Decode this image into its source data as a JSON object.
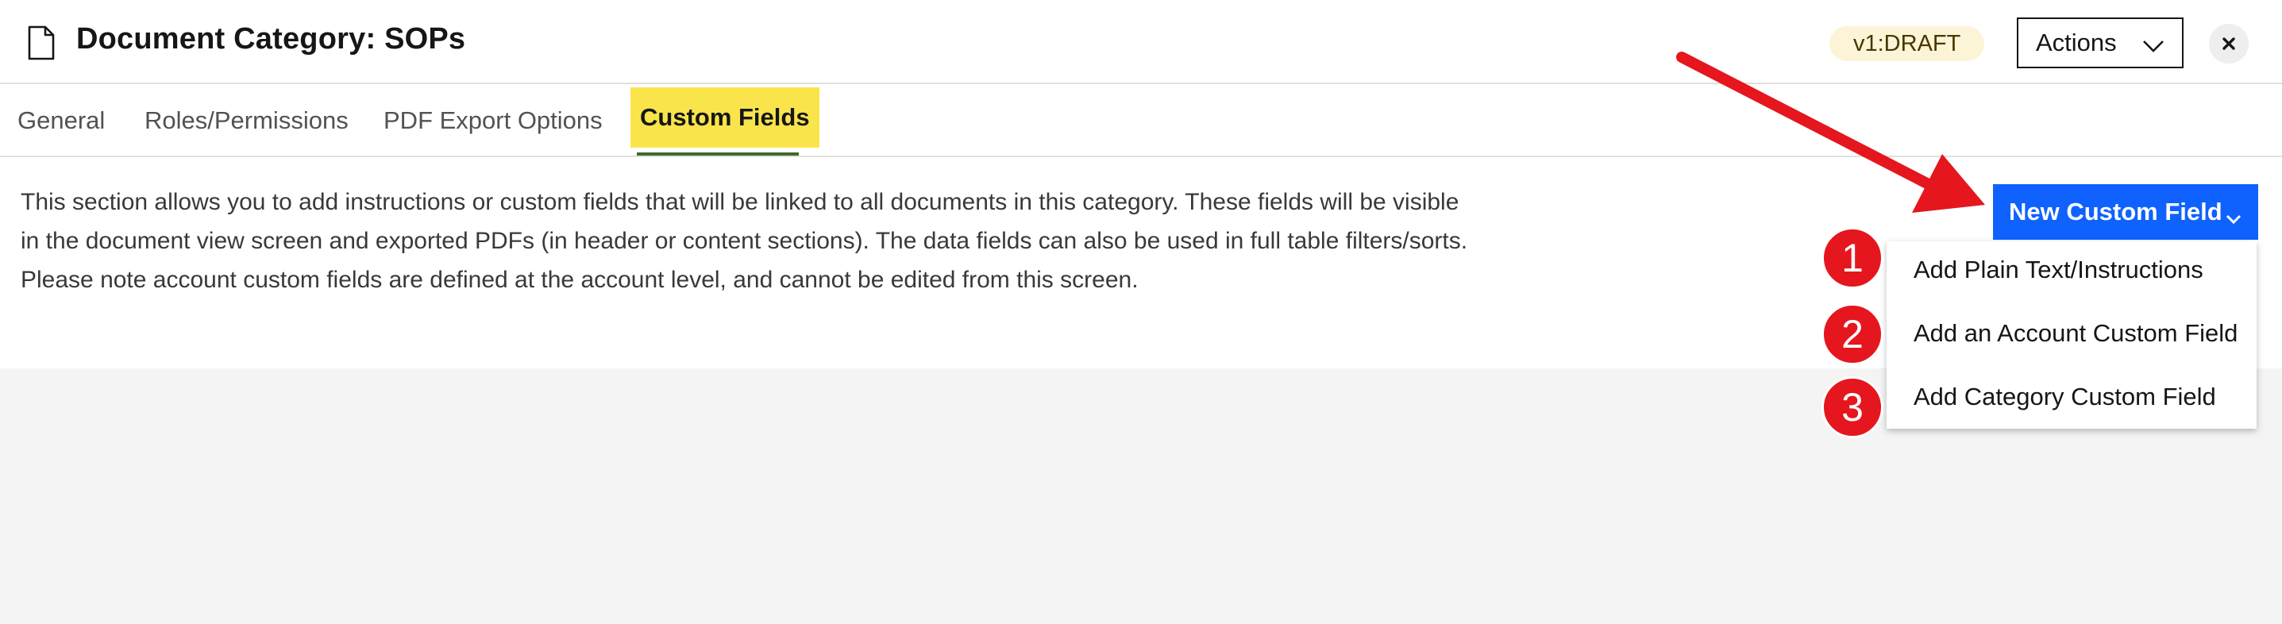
{
  "header": {
    "title": "Document Category: SOPs",
    "version_badge": "v1:DRAFT",
    "actions_label": "Actions",
    "icons": {
      "document": "document-icon",
      "close": "close-icon",
      "actions_chevron": "chevron-down-icon"
    }
  },
  "tabs": [
    {
      "label": "General",
      "active": false
    },
    {
      "label": "Roles/Permissions",
      "active": false
    },
    {
      "label": "PDF Export Options",
      "active": false
    },
    {
      "label": "Custom Fields",
      "active": true
    }
  ],
  "content": {
    "description_lines": [
      "This section allows you to add instructions or custom fields that will be linked to all documents in this category. These fields will be visible",
      "in the document view screen and exported PDFs (in header or content sections). The data fields can also be used in full table filters/sorts.",
      "Please note account custom fields are defined at the account level, and cannot be edited from this screen."
    ]
  },
  "new_custom_field": {
    "label": "New Custom Field",
    "menu": [
      {
        "label": "Add Plain Text/Instructions",
        "marker": "1"
      },
      {
        "label": "Add an Account Custom Field",
        "marker": "2"
      },
      {
        "label": "Add Category Custom Field",
        "marker": "3"
      }
    ]
  },
  "colors": {
    "primary_button": "#0f62fe",
    "active_tab_highlight": "#fae44b",
    "active_tab_underline": "#3d6b2c",
    "badge_background": "#fcf4d6",
    "annotation_red": "#e5161d"
  }
}
